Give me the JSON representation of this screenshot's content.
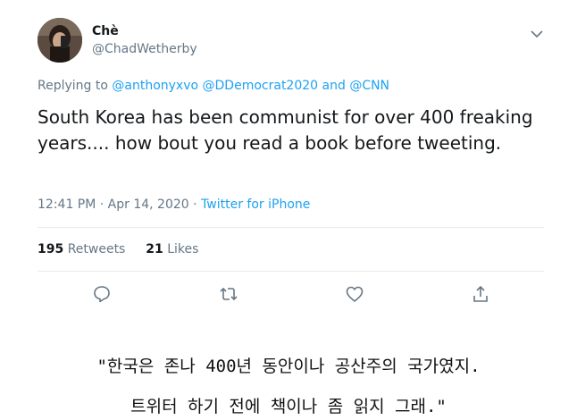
{
  "tweet": {
    "display_name": "Chè",
    "handle": "@ChadWetherby",
    "replying_prefix": "Replying to",
    "reply_to_1": "@anthonyxvo",
    "reply_to_2": "@DDemocrat2020",
    "reply_to_and": "and",
    "reply_to_3": "@CNN",
    "text": "South Korea has been communist for over 400 freaking years.... how bout you read a book before tweeting.",
    "time": "12:41 PM · Apr 14, 2020 ·",
    "source": "Twitter for iPhone",
    "retweets_count": "195",
    "retweets_label": "Retweets",
    "likes_count": "21",
    "likes_label": "Likes"
  },
  "icons": {
    "chevron": "chevron-down-icon",
    "reply": "reply-icon",
    "retweet": "retweet-icon",
    "like": "heart-icon",
    "share": "share-icon"
  },
  "caption": {
    "line1": "\"한국은 존나 400년 동안이나 공산주의 국가였지.",
    "line2": "트위터 하기 전에 책이나 좀 읽지 그래.\""
  },
  "colors": {
    "link": "#1da1f2",
    "secondary_text": "#657786",
    "primary_text": "#14171a"
  }
}
